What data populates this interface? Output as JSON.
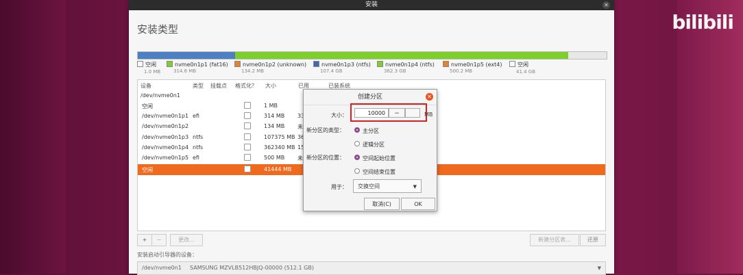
{
  "watermark": "bilibili",
  "watermark_sub": "",
  "window": {
    "title": "安装"
  },
  "page_title": "安装类型",
  "partition_bar": [
    {
      "color": "#4d7fc3",
      "flex": 142
    },
    {
      "color": "#7ecf2c",
      "flex": 486
    },
    {
      "color": "#e8e8e8",
      "flex": 56
    }
  ],
  "legend": [
    {
      "name": "空闲",
      "size": "1.0 MB",
      "color": "#ffffff"
    },
    {
      "name": "nvme0n1p1 (fat16)",
      "size": "314.6 MB",
      "color": "#7ecf2c"
    },
    {
      "name": "nvme0n1p2 (unknown)",
      "size": "134.2 MB",
      "color": "#e8822a"
    },
    {
      "name": "nvme0n1p3 (ntfs)",
      "size": "107.4 GB",
      "color": "#3a6bb5"
    },
    {
      "name": "nvme0n1p4 (ntfs)",
      "size": "362.3 GB",
      "color": "#7ecf2c"
    },
    {
      "name": "nvme0n1p5 (ext4)",
      "size": "500.2 MB",
      "color": "#e8822a"
    },
    {
      "name": "空闲",
      "size": "41.4 GB",
      "color": "#ffffff"
    }
  ],
  "table": {
    "headers": [
      "设备",
      "类型",
      "挂载点",
      "格式化？",
      "大小",
      "已用",
      "已装系统"
    ],
    "rows": [
      {
        "device": "/dev/nvme0n1",
        "type": "",
        "size": "",
        "used": "",
        "checkbox": false
      },
      {
        "device": "空闲",
        "type": "",
        "size": "1 MB",
        "used": "",
        "checkbox": true
      },
      {
        "device": "/dev/nvme0n1p1",
        "type": "efi",
        "size": "314 MB",
        "used": "33",
        "checkbox": true
      },
      {
        "device": "/dev/nvme0n1p2",
        "type": "",
        "size": "134 MB",
        "used": "未",
        "checkbox": true
      },
      {
        "device": "/dev/nvme0n1p3",
        "type": "ntfs",
        "size": "107375 MB",
        "used": "36",
        "checkbox": true
      },
      {
        "device": "/dev/nvme0n1p4",
        "type": "ntfs",
        "size": "362340 MB",
        "used": "15",
        "checkbox": true
      },
      {
        "device": "/dev/nvme0n1p5",
        "type": "efi",
        "size": "500 MB",
        "used": "未",
        "checkbox": true
      },
      {
        "device": "空闲",
        "type": "",
        "size": "41444 MB",
        "used": "",
        "checkbox": true,
        "selected": true
      }
    ]
  },
  "toolbar": {
    "add": "+",
    "remove": "−",
    "change": "更改...",
    "new_table": "新建分区表...",
    "revert": "还原"
  },
  "boot": {
    "label": "安装启动引导器的设备：",
    "device": "/dev/nvme0n1",
    "model": "SAMSUNG MZVLB512HBJQ-00000 (512.1 GB)"
  },
  "dialog": {
    "title": "创建分区",
    "size_label": "大小：",
    "size_value": "10000",
    "size_minus": "−",
    "size_unit": "MB",
    "type_label": "新分区的类型：",
    "type_primary": "主分区",
    "type_logical": "逻辑分区",
    "location_label": "新分区的位置：",
    "loc_start": "空间起始位置",
    "loc_end": "空间结束位置",
    "use_label": "用于：",
    "use_value": "交换空间",
    "cancel": "取消(C)",
    "ok": "OK"
  }
}
